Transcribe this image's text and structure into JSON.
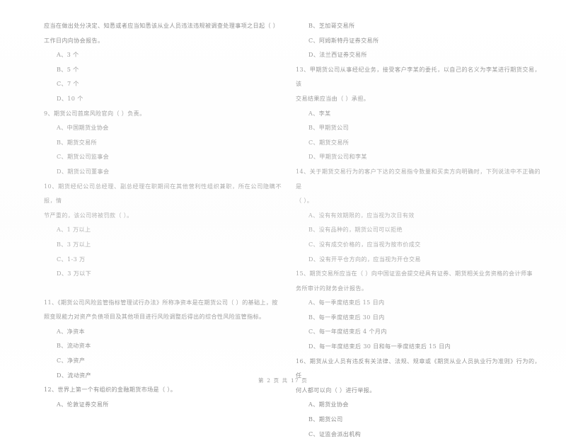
{
  "document": {
    "type": "exam-paper",
    "language": "zh-CN",
    "footer": "第 2 页 共 17 页",
    "text_color": "#8d8d8d",
    "background_color": "#ffffff"
  },
  "left_column": {
    "carryover": {
      "line1": "应当在做出处分决定、知悉或者应当知悉该从业人员违法违规被调查处理事项之日起（    ）",
      "line2": "工作日内向协会报告。",
      "options": [
        "A、3 个",
        "B、5 个",
        "C、7 个",
        "D、10 个"
      ]
    },
    "questions": [
      {
        "number": "9、",
        "stem": "期货公司首席风险官向（      ）负责。",
        "continuation": "",
        "options": [
          "A、中国期货业协会",
          "B、期货交易所",
          "C、期货公司监事会",
          "D、期货公司董事会"
        ]
      },
      {
        "number": "10、",
        "stem": "期货经纪公司总经理、副总经理在职期间在其他营利性组织兼职，所在公司隐瞒不报，情",
        "continuation": "节严重的，该公司将被罚款（      ）。",
        "options": [
          "A、1 万以上",
          "B、3 万以上",
          "C、1-3 万",
          "D、3 万以下"
        ]
      },
      {
        "number": "11、",
        "stem": "《期货公司风险监管指标管理试行办法》所称净资本是在期货公司（      ）的基础上，按",
        "continuation": "照变现能力对资产负债项目及其他项目进行风险调整后得出的综合性风险监管指标。",
        "options": [
          "A、净资本",
          "B、流动资本",
          "C、净资产",
          "D、流动资产"
        ]
      },
      {
        "number": "12、",
        "stem": "世界上第一个有组织的金融期货市场是（      ）。",
        "continuation": "",
        "options": [
          "A、伦敦证券交易所"
        ]
      }
    ]
  },
  "right_column": {
    "carryover": {
      "options": [
        "B、芝加哥交易所",
        "C、阿姆斯特丹证券交易所",
        "D、法兰西证券交易所"
      ]
    },
    "questions": [
      {
        "number": "13、",
        "stem": "甲期货公司从事经纪业务，接受客户李某的委托，以自己的名义为李某进行期货交易，该",
        "continuation": "交易结果应当由（      ）承担。",
        "options": [
          "A、李某",
          "B、甲期货公司",
          "C、期货交易所",
          "D、甲期货公司和李某"
        ]
      },
      {
        "number": "14、",
        "stem": "关于期货交易行为的客户下达的交易指令数量和买卖方向明确时，下列说法中不正确的是",
        "continuation": "（      ）。",
        "options": [
          "A、没有有效期限的，应当视为次日有效",
          "B、没有品种的，期货公司可以拒绝",
          "C、没有成交价格的，应当视为按市价成交",
          "D、没有开平仓方向的，应当视为开仓交易"
        ]
      },
      {
        "number": "15、",
        "stem": "期货交易所应当在（      ）向中国证监会提交经具有证券、期货相关业务资格的会计师事",
        "continuation": "务所审计的财务会计报告。",
        "options": [
          "A、每一季度结束后 15 日内",
          "B、每一季度结束后 30 日内",
          "C、每一年度结束后 4 个月内",
          "D、每一年度结束后 30 日和每一季度结束后 15 日内"
        ]
      },
      {
        "number": "16、",
        "stem": "期货从业人员有违反有关法律、法规、规章或《期货从业人员执业行为准则》行为的，任",
        "continuation": "何人都可以向（      ）进行举报。",
        "options": [
          "A、期货业协会",
          "B、期货公司",
          "C、证监会派出机构"
        ]
      }
    ]
  }
}
